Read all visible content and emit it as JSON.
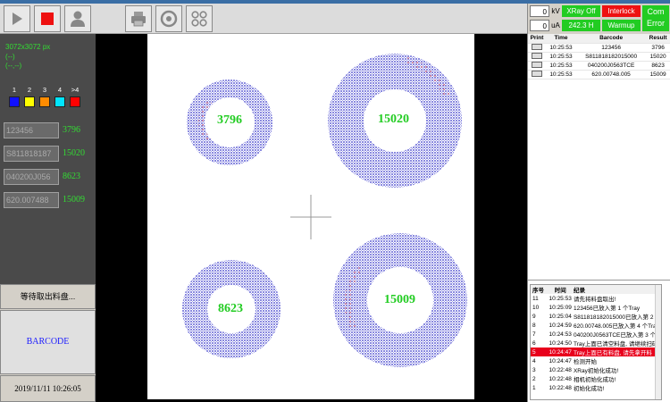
{
  "status": {
    "kv_value": "0",
    "kv_unit": "kV",
    "ua_value": "0",
    "ua_unit": "uA",
    "xray": "XRay Off",
    "interlock": "Interlock",
    "current": "242.3 H",
    "warmup": "Warmup",
    "com": "Com",
    "error": "Error"
  },
  "left": {
    "resolution": "3072x3072 px",
    "line1": "(--)",
    "line2": "(--,--)",
    "legend": [
      {
        "label": "1",
        "color": "#1010ff"
      },
      {
        "label": "2",
        "color": "#ffff00"
      },
      {
        "label": "3",
        "color": "#ff8c00"
      },
      {
        "label": "4",
        "color": "#00e5ff"
      },
      {
        "label": ">4",
        "color": "#ff0000"
      }
    ],
    "codes": [
      {
        "code": "123456",
        "count": "3796"
      },
      {
        "code": "S811818187",
        "count": "15020"
      },
      {
        "code": "040200J056",
        "count": "8623"
      },
      {
        "code": "620.007488",
        "count": "15009"
      }
    ],
    "waiting": "等待取出料盘...",
    "barcode": "BARCODE",
    "datetime": "2019/11/11 10:26:05"
  },
  "rings": [
    "3796",
    "15020",
    "8623",
    "15009"
  ],
  "print_table": {
    "headers": [
      "Print",
      "Time",
      "Barcode",
      "Result"
    ],
    "rows": [
      {
        "time": "10:25:53",
        "barcode": "123456",
        "result": "3796"
      },
      {
        "time": "10:25:53",
        "barcode": "S811818182015000",
        "result": "15020"
      },
      {
        "time": "10:25:53",
        "barcode": "040200J0563TCE",
        "result": "8623"
      },
      {
        "time": "10:25:53",
        "barcode": "620.00748.005",
        "result": "15009"
      }
    ]
  },
  "log_table": {
    "headers": [
      "序号",
      "时间",
      "纪录"
    ],
    "rows": [
      {
        "no": "11",
        "time": "10:25:53",
        "msg": "请先将料盘取出!"
      },
      {
        "no": "10",
        "time": "10:25:09",
        "msg": "123456已放入第 1 个Tray"
      },
      {
        "no": "9",
        "time": "10:25:04",
        "msg": "S811818182015000已放入第 2 个"
      },
      {
        "no": "8",
        "time": "10:24:59",
        "msg": "620.00748.005已放入第 4 个Tray"
      },
      {
        "no": "7",
        "time": "10:24:53",
        "msg": "040200J0563TCE已放入第 3 个Tr"
      },
      {
        "no": "6",
        "time": "10:24:50",
        "msg": "Tray上面已清空料盘, 请继续扫码"
      },
      {
        "no": "5",
        "time": "10:24:47",
        "msg": "Tray上面已有料盘, 请先拿开料",
        "red": true
      },
      {
        "no": "4",
        "time": "10:24:47",
        "msg": "检测开始"
      },
      {
        "no": "3",
        "time": "10:22:48",
        "msg": "XRay初始化成功!"
      },
      {
        "no": "2",
        "time": "10:22:48",
        "msg": "相机初始化成功!"
      },
      {
        "no": "1",
        "time": "10:22:48",
        "msg": "初始化成功!"
      }
    ]
  }
}
